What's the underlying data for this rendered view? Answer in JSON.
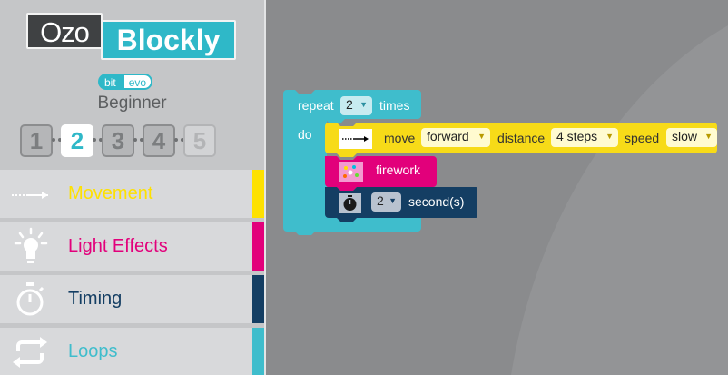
{
  "logo": {
    "part1": "Ozo",
    "part2": "Blockly"
  },
  "brand": {
    "bit": "bit",
    "evo": "evo"
  },
  "level": {
    "name": "Beginner",
    "options": [
      "1",
      "2",
      "3",
      "4",
      "5"
    ],
    "selected": "2"
  },
  "categories": [
    {
      "label": "Movement",
      "color": "#fee100",
      "icon": "arrow-icon"
    },
    {
      "label": "Light Effects",
      "color": "#e2007b",
      "icon": "light-bulb-icon"
    },
    {
      "label": "Timing",
      "color": "#143e63",
      "icon": "stopwatch-icon"
    },
    {
      "label": "Loops",
      "color": "#3fbdcc",
      "icon": "loop-icon"
    }
  ],
  "blocks": {
    "repeat": {
      "label_repeat": "repeat",
      "count": "2",
      "label_times": "times",
      "label_do": "do",
      "color": "#3fbdcc"
    },
    "move": {
      "label_move": "move",
      "direction": "forward",
      "label_distance": "distance",
      "distance": "4 steps",
      "label_speed": "speed",
      "speed": "slow",
      "color": "#f7db18"
    },
    "firework": {
      "label": "firework",
      "color": "#e2007b"
    },
    "wait": {
      "seconds": "2",
      "label_seconds": "second(s)",
      "color": "#143e63"
    }
  }
}
